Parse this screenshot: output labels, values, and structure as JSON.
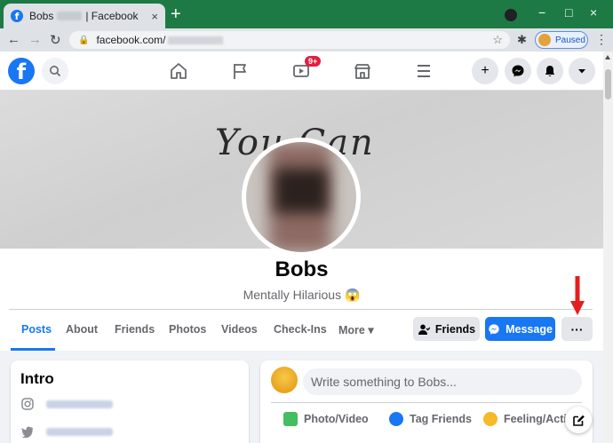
{
  "browser": {
    "tab": {
      "title_prefix": "Bobs",
      "title_suffix": "| Facebook",
      "favicon": "f",
      "close": "×"
    },
    "new_tab": "+",
    "window": {
      "minimize": "−",
      "maximize": "□",
      "close": "×"
    },
    "nav": {
      "back": "←",
      "forward": "→",
      "reload": "↻"
    },
    "address": {
      "url": "facebook.com/"
    },
    "profile_chip": {
      "label": "Paused"
    }
  },
  "fb_nav": {
    "logo": "f",
    "watch_badge": "9+",
    "create": "+"
  },
  "profile": {
    "cover_text": "You Can",
    "name": "Bobs",
    "bio": "Mentally Hilarious 😱",
    "tabs": [
      {
        "label": "Posts"
      },
      {
        "label": "About"
      },
      {
        "label": "Friends"
      },
      {
        "label": "Photos"
      },
      {
        "label": "Videos"
      },
      {
        "label": "Check-Ins"
      },
      {
        "label": "More ▾"
      }
    ],
    "actions": {
      "friends": "Friends",
      "message": "Message",
      "more": "···"
    }
  },
  "intro": {
    "title": "Intro"
  },
  "composer": {
    "placeholder": "Write something to Bobs...",
    "actions": [
      {
        "label": "Photo/Video",
        "color": "#45bd62"
      },
      {
        "label": "Tag Friends",
        "color": "#1877f2"
      },
      {
        "label": "Feeling/Activ",
        "color": "#f7b928"
      }
    ]
  },
  "colors": {
    "accent": "#1877f2",
    "arrow": "#e41e1e"
  }
}
